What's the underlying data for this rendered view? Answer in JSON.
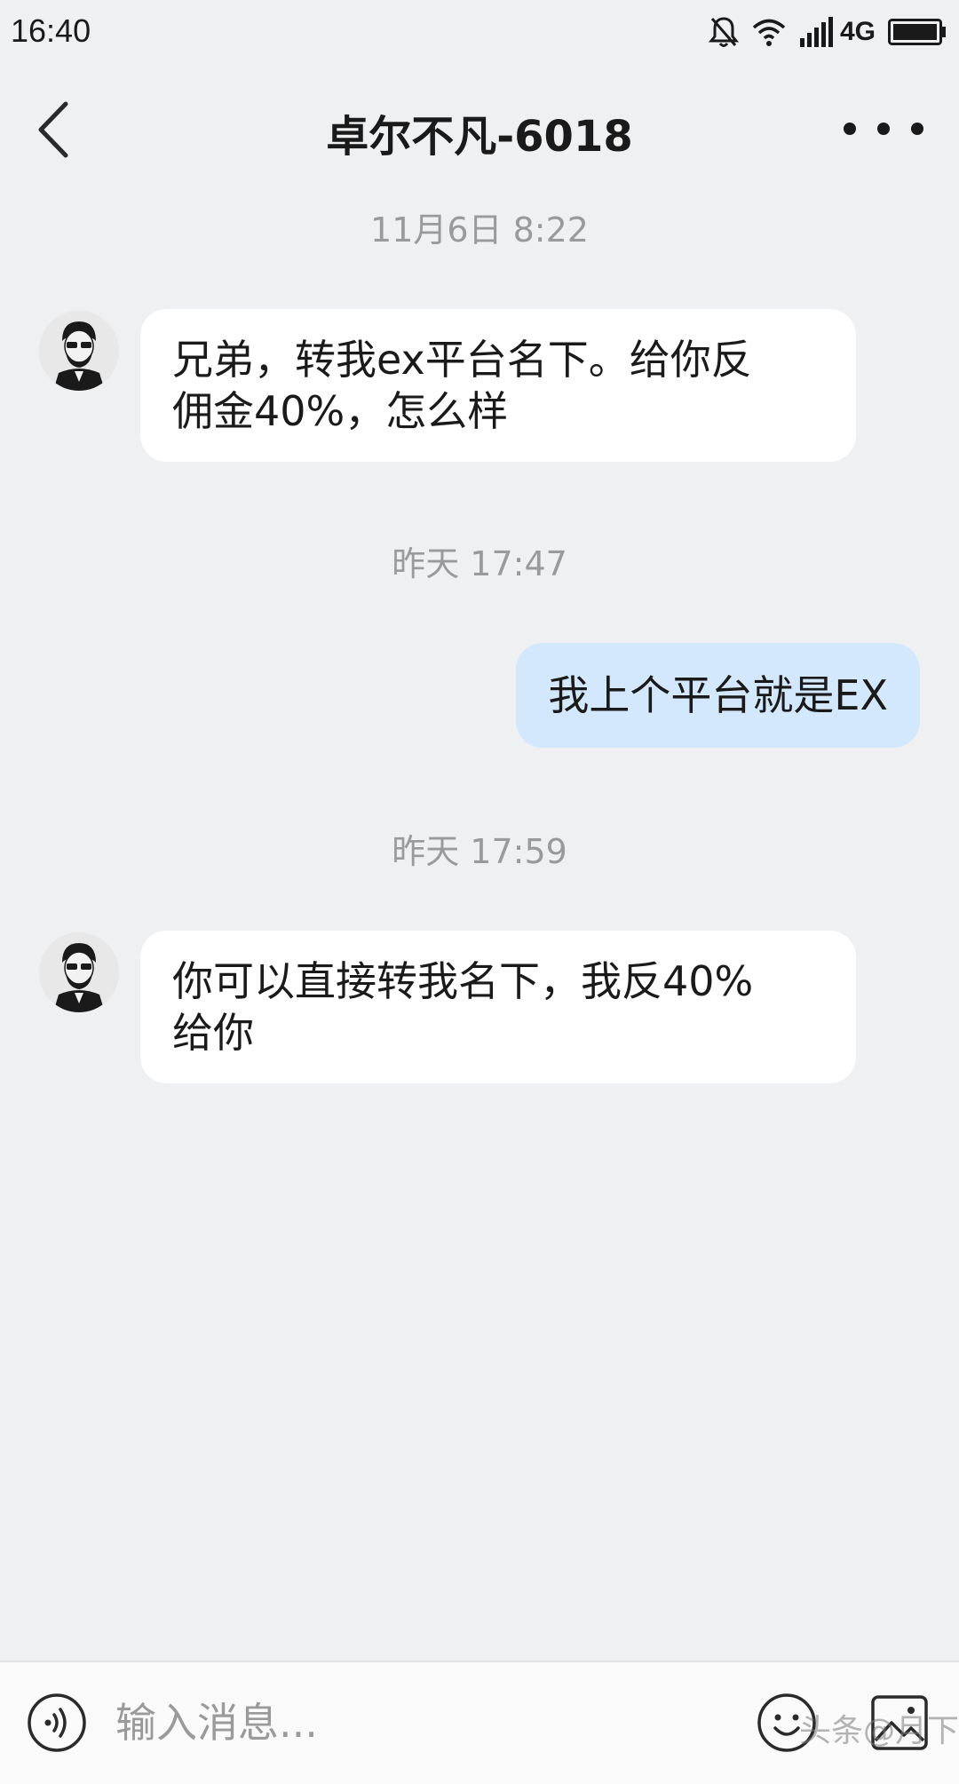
{
  "status_bar": {
    "time": "16:40",
    "network": "4G",
    "icons": [
      "bell-off-icon",
      "wifi-icon",
      "signal-icon",
      "battery-icon"
    ]
  },
  "header": {
    "title": "卓尔不凡-6018",
    "back_icon": "chevron-left-icon",
    "more_icon": "more-horizontal-icon"
  },
  "messages": [
    {
      "type": "timestamp",
      "text": "11月6日 8:22"
    },
    {
      "type": "incoming",
      "lines": [
        "兄弟，转我ex平台名下。给你反",
        "佣金40%，怎么样"
      ]
    },
    {
      "type": "timestamp",
      "text": "昨天 17:47"
    },
    {
      "type": "outgoing",
      "lines": [
        "我上个平台就是EX"
      ]
    },
    {
      "type": "timestamp",
      "text": "昨天 17:59"
    },
    {
      "type": "incoming",
      "lines": [
        "你可以直接转我名下，我反40%",
        "给你"
      ]
    }
  ],
  "input_bar": {
    "placeholder": "输入消息...",
    "voice_icon": "voice-icon",
    "emoji_icon": "emoji-icon",
    "image_icon": "image-icon"
  },
  "watermark": "头条@月下仙",
  "colors": {
    "background": "#eff0f2",
    "incoming_bubble": "#ffffff",
    "outgoing_bubble": "#d4e8fd",
    "timestamp_text": "#9a9a9a"
  }
}
